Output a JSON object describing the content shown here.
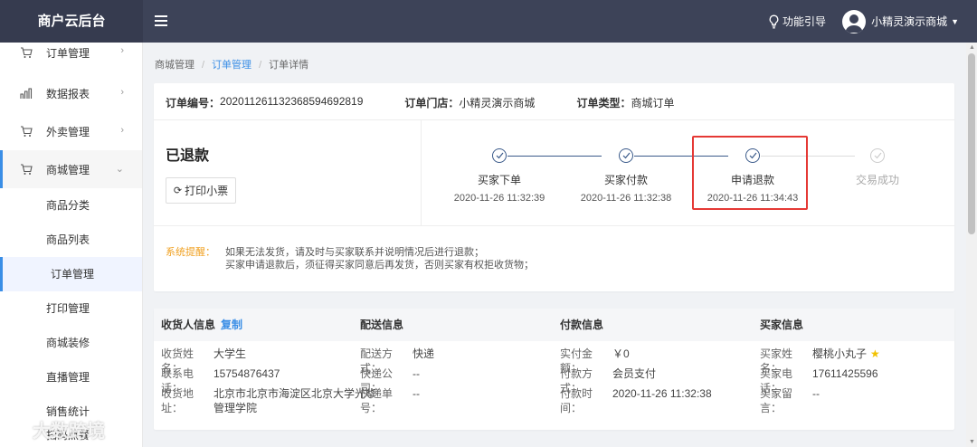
{
  "app": {
    "title": "商户云后台"
  },
  "topbar": {
    "help": "功能引导",
    "user": "小精灵演示商城"
  },
  "sidebar": {
    "items": [
      {
        "label": "订单管理",
        "icon": "cart-icon"
      },
      {
        "label": "数据报表",
        "icon": "bar-chart-icon"
      },
      {
        "label": "外卖管理",
        "icon": "cart-icon"
      },
      {
        "label": "商城管理",
        "icon": "cart-icon"
      }
    ],
    "sub": [
      "商品分类",
      "商品列表",
      "订单管理",
      "打印管理",
      "商城装修",
      "直播管理",
      "销售统计",
      "扫码点餐"
    ]
  },
  "breadcrumb": {
    "a": "商城管理",
    "b": "订单管理",
    "c": "订单详情"
  },
  "order": {
    "no_label": "订单编号：",
    "no": "20201126113236859469281​9",
    "store_label": "订单门店：",
    "store": "小精灵演示商城",
    "type_label": "订单类型：",
    "type": "商城订单"
  },
  "status": "已退款",
  "print_label": "打印小票",
  "steps": [
    {
      "name": "买家下单",
      "time": "2020-11-26 11:32:39",
      "done": true
    },
    {
      "name": "买家付款",
      "time": "2020-11-26 11:32:38",
      "done": true
    },
    {
      "name": "申请退款",
      "time": "2020-11-26 11:34:43",
      "done": true
    },
    {
      "name": "交易成功",
      "time": "",
      "done": false
    }
  ],
  "notice": {
    "label": "系统提醒：",
    "line1": "如果无法发货，请及时与买家联系并说明情况后进行退款；",
    "line2": "买家申请退款后，须征得买家同意后再发货，否则买家有权拒收货物；"
  },
  "receiver": {
    "title": "收货人信息",
    "copy": "复制",
    "name_k": "收货姓名：",
    "name_v": "大学生",
    "phone_k": "联系电话：",
    "phone_v": "15754876437",
    "addr_k": "收货地址：",
    "addr_v1": "北京市北京市海淀区北京大学光华",
    "addr_v2": "管理学院"
  },
  "delivery": {
    "title": "配送信息",
    "method_k": "配送方式：",
    "method_v": "快递",
    "company_k": "快递公司：",
    "company_v": "--",
    "no_k": "快递单号：",
    "no_v": "--"
  },
  "payment": {
    "title": "付款信息",
    "amount_k": "实付金额：",
    "amount_v": "￥0",
    "method_k": "付款方式：",
    "method_v": "会员支付",
    "time_k": "付款时间：",
    "time_v": "2020-11-26 11:32:38"
  },
  "buyer": {
    "title": "买家信息",
    "name_k": "买家姓名：",
    "name_v": "樱桃小丸子",
    "phone_k": "买家电话：",
    "phone_v": "17611425596",
    "msg_k": "买家留言：",
    "msg_v": "--"
  },
  "watermark": "大数跨境",
  "colors": {
    "topbar": "#3d4358",
    "accent": "#3a8ee6",
    "highlight": "#e53935",
    "notice": "#f0a020"
  }
}
